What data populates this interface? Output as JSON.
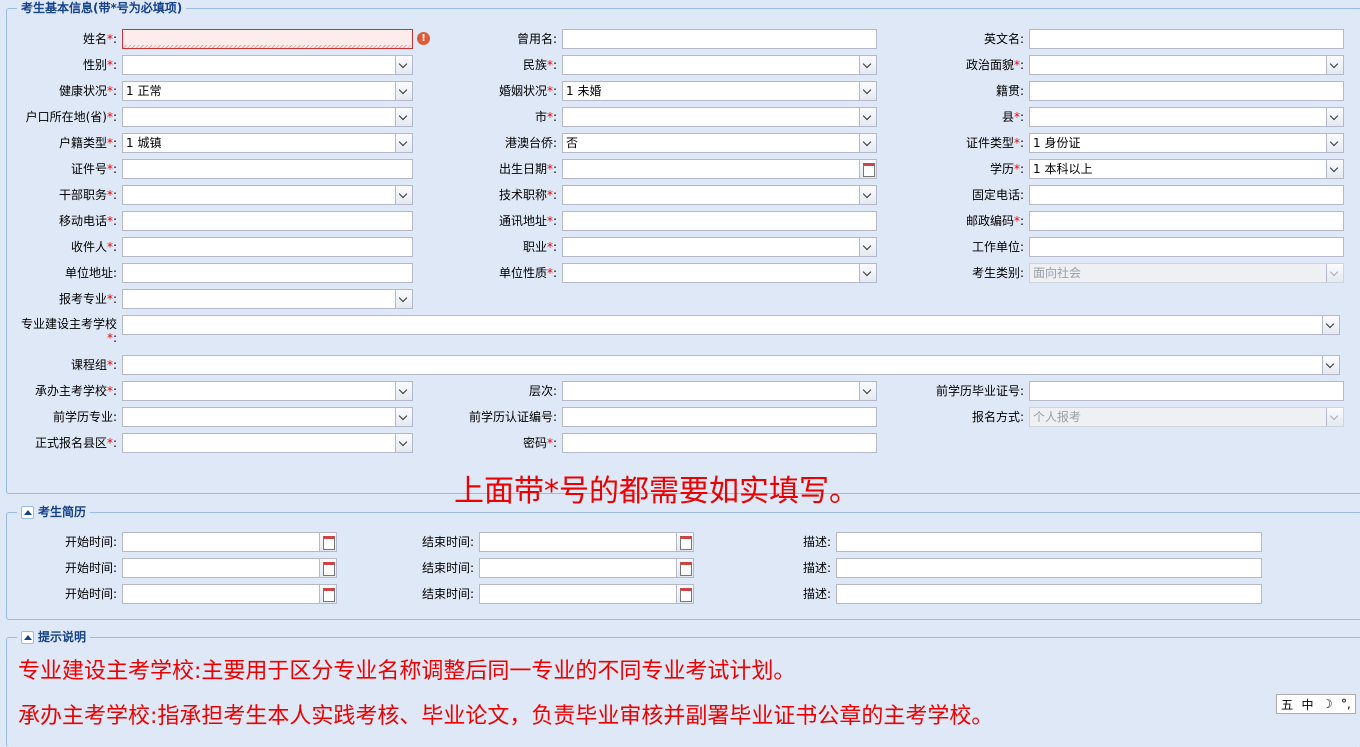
{
  "basic_info": {
    "legend": "考生基本信息(带*号为必填项)",
    "req": "*",
    "colon": ":",
    "fields": [
      {
        "label": "姓名",
        "required": true,
        "value": "",
        "type": "text",
        "invalid": true
      },
      {
        "label": "曾用名",
        "required": false,
        "value": "",
        "type": "text"
      },
      {
        "label": "英文名",
        "required": false,
        "value": "",
        "type": "text"
      },
      {
        "label": "性别",
        "required": true,
        "value": "",
        "type": "select"
      },
      {
        "label": "民族",
        "required": true,
        "value": "",
        "type": "select"
      },
      {
        "label": "政治面貌",
        "required": true,
        "value": "",
        "type": "select"
      },
      {
        "label": "健康状况",
        "required": true,
        "value": "1 正常",
        "type": "select"
      },
      {
        "label": "婚姻状况",
        "required": true,
        "value": "1 未婚",
        "type": "select"
      },
      {
        "label": "籍贯",
        "required": false,
        "value": "",
        "type": "text"
      },
      {
        "label": "户口所在地(省)",
        "required": true,
        "value": "",
        "type": "select"
      },
      {
        "label": "市",
        "required": true,
        "value": "",
        "type": "select"
      },
      {
        "label": "县",
        "required": true,
        "value": "",
        "type": "select"
      },
      {
        "label": "户籍类型",
        "required": true,
        "value": "1 城镇",
        "type": "select"
      },
      {
        "label": "港澳台侨",
        "required": false,
        "value": "否",
        "type": "select"
      },
      {
        "label": "证件类型",
        "required": true,
        "value": "1 身份证",
        "type": "select"
      },
      {
        "label": "证件号",
        "required": true,
        "value": "",
        "type": "text"
      },
      {
        "label": "出生日期",
        "required": true,
        "value": "",
        "type": "date"
      },
      {
        "label": "学历",
        "required": true,
        "value": "1 本科以上",
        "type": "select"
      },
      {
        "label": "干部职务",
        "required": true,
        "value": "",
        "type": "select"
      },
      {
        "label": "技术职称",
        "required": true,
        "value": "",
        "type": "select"
      },
      {
        "label": "固定电话",
        "required": false,
        "value": "",
        "type": "text"
      },
      {
        "label": "移动电话",
        "required": true,
        "value": "",
        "type": "text"
      },
      {
        "label": "通讯地址",
        "required": true,
        "value": "",
        "type": "text"
      },
      {
        "label": "邮政编码",
        "required": true,
        "value": "",
        "type": "text"
      },
      {
        "label": "收件人",
        "required": true,
        "value": "",
        "type": "text"
      },
      {
        "label": "职业",
        "required": true,
        "value": "",
        "type": "select"
      },
      {
        "label": "工作单位",
        "required": false,
        "value": "",
        "type": "text"
      },
      {
        "label": "单位地址",
        "required": false,
        "value": "",
        "type": "text"
      },
      {
        "label": "单位性质",
        "required": true,
        "value": "",
        "type": "select"
      },
      {
        "label": "考生类别",
        "required": false,
        "value": "面向社会",
        "type": "select",
        "disabled": true
      },
      {
        "label": "报考专业",
        "required": true,
        "value": "",
        "type": "select"
      },
      {
        "label": "专业建设主考学校",
        "required": true,
        "value": "",
        "type": "select"
      },
      {
        "label": "课程组",
        "required": true,
        "value": "",
        "type": "select"
      },
      {
        "label": "承办主考学校",
        "required": true,
        "value": "",
        "type": "select"
      },
      {
        "label": "层次",
        "required": false,
        "value": "",
        "type": "select"
      },
      {
        "label": "前学历毕业证号",
        "required": false,
        "value": "",
        "type": "text"
      },
      {
        "label": "前学历专业",
        "required": false,
        "value": "",
        "type": "select"
      },
      {
        "label": "前学历认证编号",
        "required": false,
        "value": "",
        "type": "text"
      },
      {
        "label": "报名方式",
        "required": false,
        "value": "个人报考",
        "type": "select",
        "disabled": true
      },
      {
        "label": "正式报名县区",
        "required": true,
        "value": "",
        "type": "select"
      },
      {
        "label": "密码",
        "required": true,
        "value": "",
        "type": "text"
      }
    ],
    "annotation": "上面带*号的都需要如实填写。"
  },
  "resume": {
    "legend": "考生简历",
    "start_label": "开始时间:",
    "end_label": "结束时间:",
    "desc_label": "描述:",
    "rows": [
      {
        "start": "",
        "end": "",
        "desc": ""
      },
      {
        "start": "",
        "end": "",
        "desc": ""
      },
      {
        "start": "",
        "end": "",
        "desc": ""
      }
    ]
  },
  "tips": {
    "legend": "提示说明",
    "lines": [
      "专业建设主考学校:主要用于区分专业名称调整后同一专业的不同专业考试计划。",
      "承办主考学校:指承担考生本人实践考核、毕业论文，负责毕业审核并副署毕业证书公章的主考学校。"
    ]
  },
  "ime_bar": {
    "items": [
      "五",
      "中",
      "☽",
      "°,"
    ]
  },
  "colors": {
    "required_mark": "#e00000",
    "accent": "#15428b",
    "border": "#99bbe8",
    "background": "#dfe8f6"
  }
}
